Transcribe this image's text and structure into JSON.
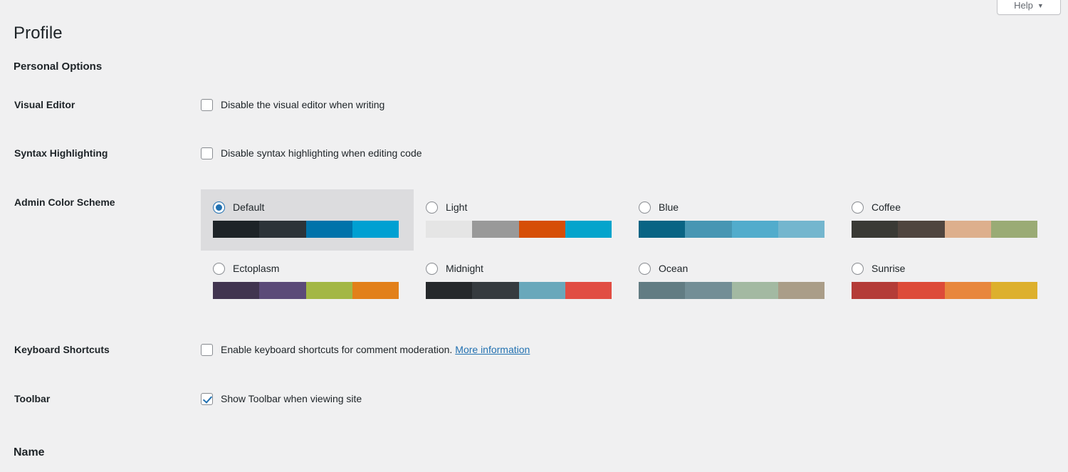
{
  "header": {
    "help_label": "Help",
    "help_caret": "▼"
  },
  "page": {
    "title": "Profile"
  },
  "sections": {
    "personal_options": "Personal Options",
    "name": "Name"
  },
  "rows": {
    "visual_editor": {
      "label": "Visual Editor",
      "checkbox_label": "Disable the visual editor when writing",
      "checked": false
    },
    "syntax_highlighting": {
      "label": "Syntax Highlighting",
      "checkbox_label": "Disable syntax highlighting when editing code",
      "checked": false
    },
    "admin_color_scheme": {
      "label": "Admin Color Scheme"
    },
    "keyboard_shortcuts": {
      "label": "Keyboard Shortcuts",
      "checkbox_label": "Enable keyboard shortcuts for comment moderation.",
      "link_label": "More information",
      "checked": false
    },
    "toolbar": {
      "label": "Toolbar",
      "checkbox_label": "Show Toolbar when viewing site",
      "checked": true
    }
  },
  "color_schemes": {
    "selected": "Default",
    "items": [
      {
        "name": "Default",
        "selected": true,
        "colors": [
          "#1d2327",
          "#2c3338",
          "#0073aa",
          "#00a0d2"
        ]
      },
      {
        "name": "Light",
        "selected": false,
        "colors": [
          "#e5e5e5",
          "#999999",
          "#d64e07",
          "#04a4cc"
        ]
      },
      {
        "name": "Blue",
        "selected": false,
        "colors": [
          "#096484",
          "#4796b3",
          "#52accc",
          "#74b6ce"
        ]
      },
      {
        "name": "Coffee",
        "selected": false,
        "colors": [
          "#3a3a35",
          "#4f453f",
          "#ddaf8d",
          "#9aab75"
        ]
      },
      {
        "name": "Ectoplasm",
        "selected": false,
        "colors": [
          "#413550",
          "#5b4a78",
          "#a3b745",
          "#e2801a"
        ]
      },
      {
        "name": "Midnight",
        "selected": false,
        "colors": [
          "#25282b",
          "#363b3f",
          "#69a8bb",
          "#e14d43"
        ]
      },
      {
        "name": "Ocean",
        "selected": false,
        "colors": [
          "#627c83",
          "#738e96",
          "#a3b9a2",
          "#aa9d88"
        ]
      },
      {
        "name": "Sunrise",
        "selected": false,
        "colors": [
          "#b43c38",
          "#dd4b39",
          "#e8873d",
          "#ddb02d"
        ]
      }
    ]
  },
  "colors": {
    "background": "#f0f0f1",
    "text": "#1d2327",
    "link": "#2271b1",
    "selected_scheme_bg": "#dcdcde"
  }
}
